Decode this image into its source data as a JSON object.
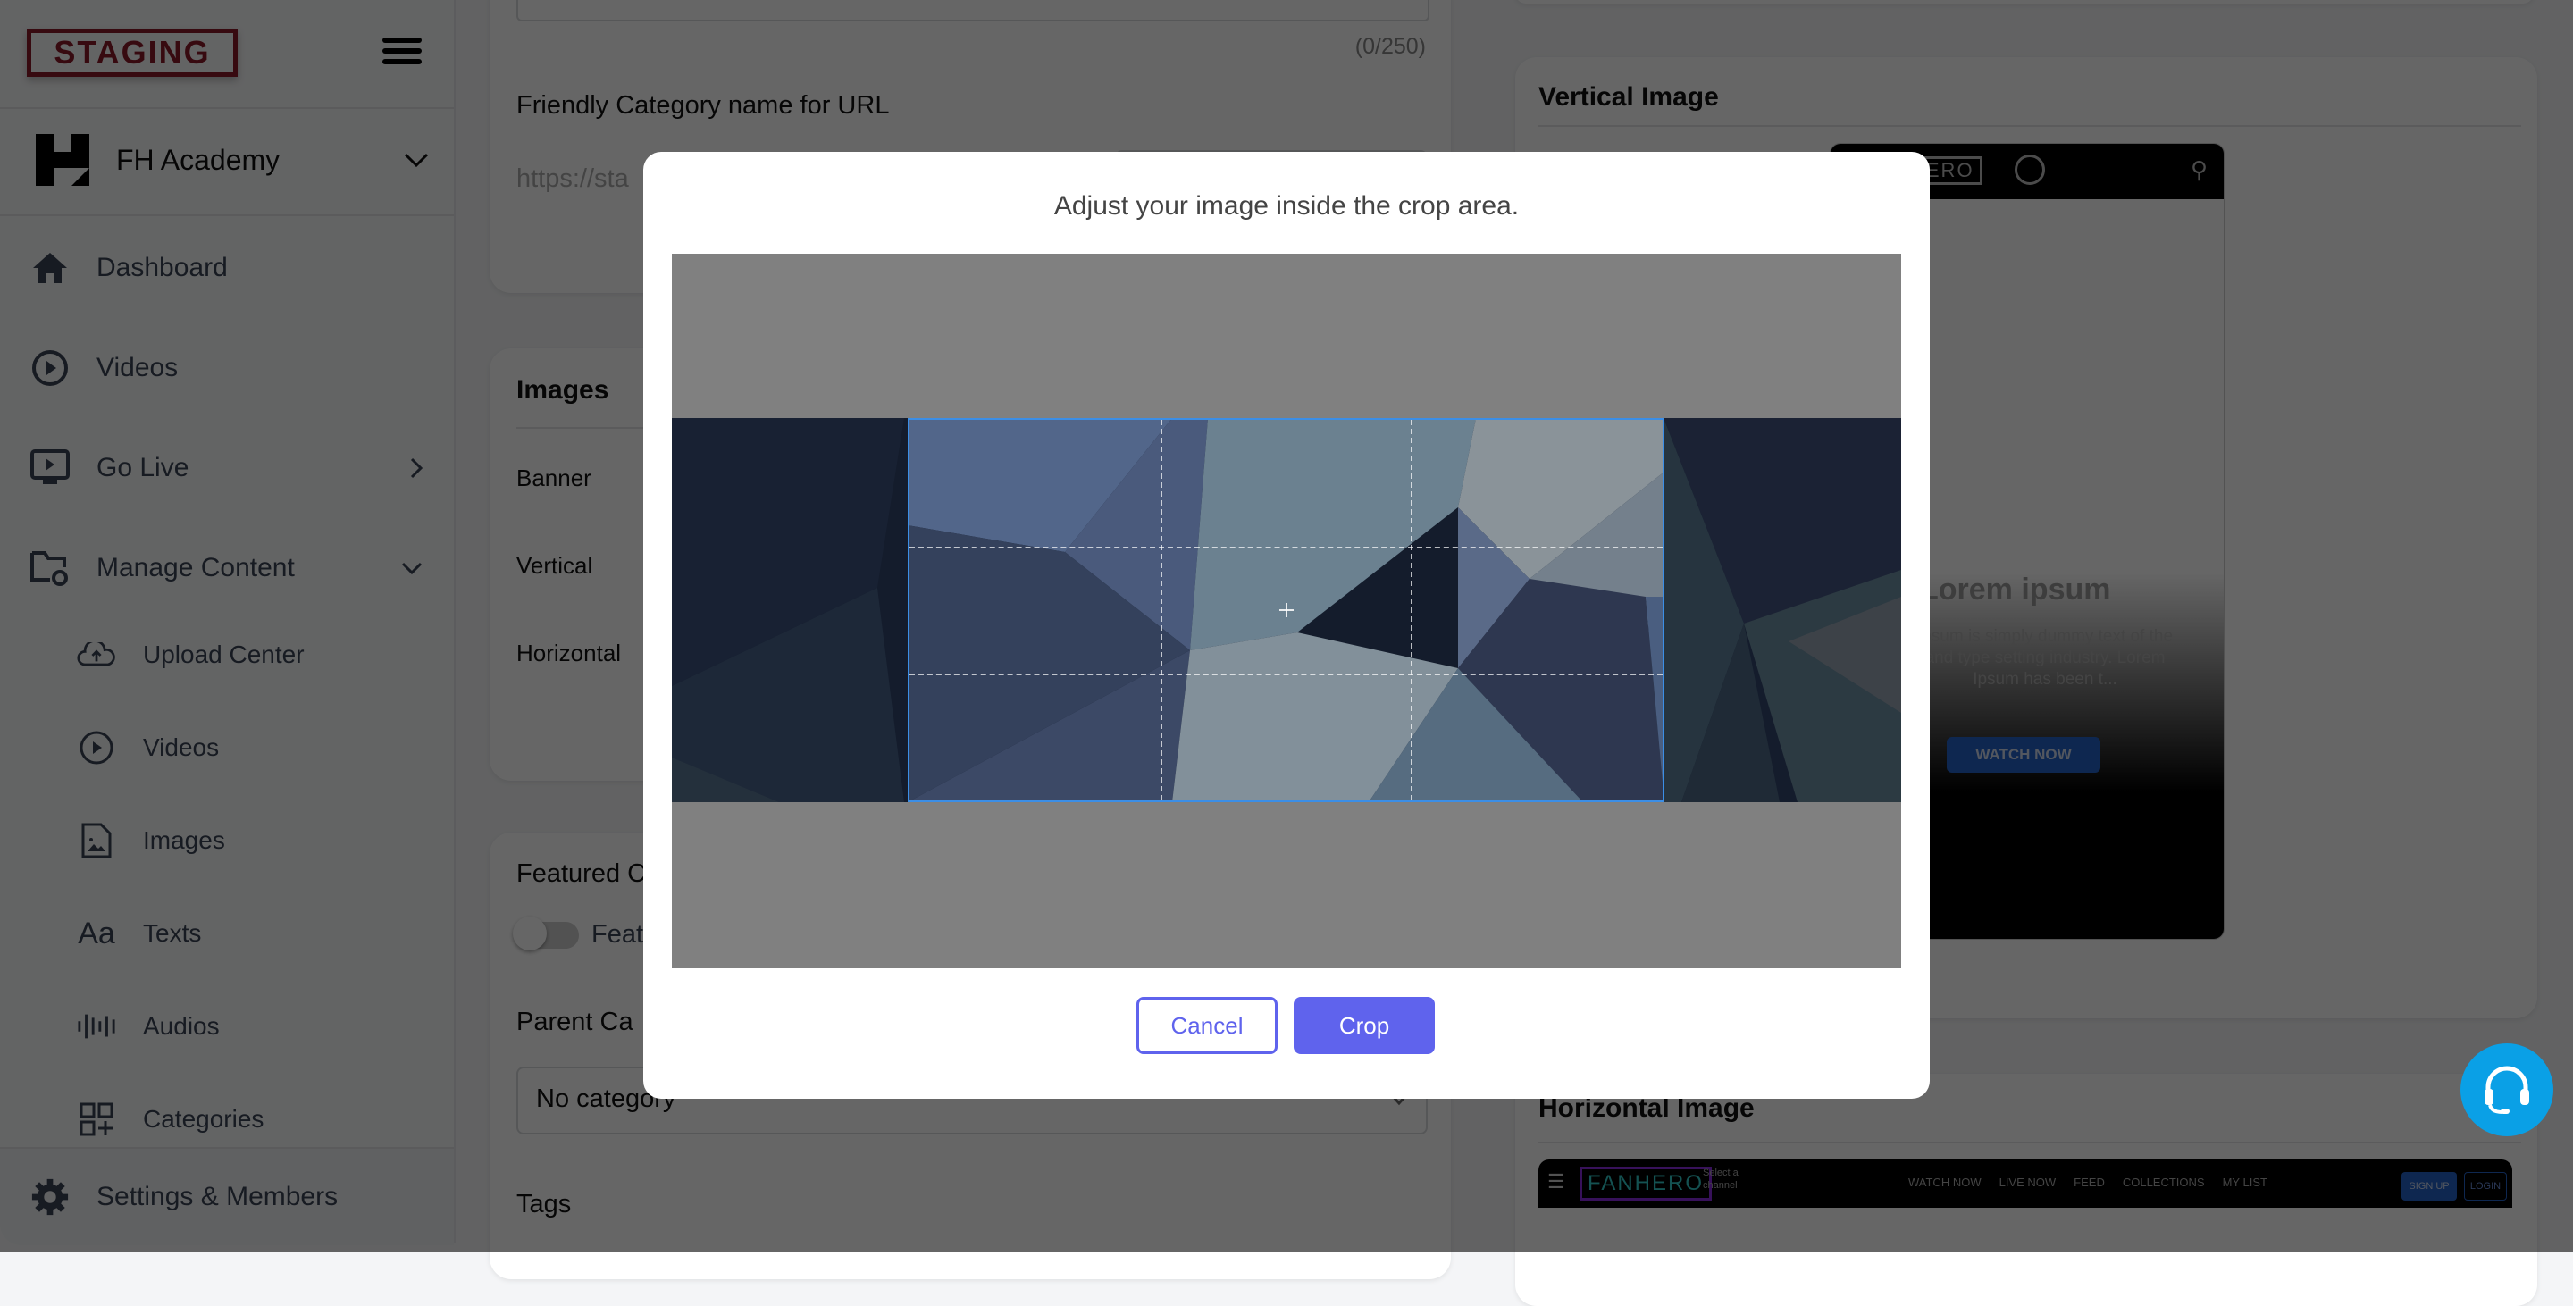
{
  "sidebar": {
    "logo": "STAGING",
    "org_name": "FH Academy",
    "items": [
      {
        "label": "Dashboard",
        "icon": "home-icon"
      },
      {
        "label": "Videos",
        "icon": "play-circle-icon"
      },
      {
        "label": "Go Live",
        "icon": "live-screen-icon"
      },
      {
        "label": "Manage Content",
        "icon": "folder-gear-icon"
      }
    ],
    "sub_items": [
      {
        "label": "Upload Center",
        "icon": "cloud-upload-icon"
      },
      {
        "label": "Videos",
        "icon": "play-circle-icon"
      },
      {
        "label": "Images",
        "icon": "image-file-icon"
      },
      {
        "label": "Texts",
        "icon": "text-icon"
      },
      {
        "label": "Audios",
        "icon": "audio-wave-icon"
      },
      {
        "label": "Categories",
        "icon": "grid-plus-icon"
      }
    ],
    "footer": {
      "label": "Settings & Members",
      "icon": "gear-icon"
    }
  },
  "form": {
    "char_count": "(0/250)",
    "friendly_name_label": "Friendly Category name for URL",
    "friendly_name_prefix": "https://sta",
    "images_title": "Images",
    "image_rows": [
      "Banner",
      "Vertical",
      "Horizontal"
    ],
    "featured_title": "Featured C",
    "featured_toggle_label": "Feat",
    "parent_category_label": "Parent Ca",
    "parent_category_value": "No category",
    "tags_label": "Tags"
  },
  "previews": {
    "vertical_title": "Vertical Image",
    "vertical_brand": "HERO",
    "vertical_hero_title": "Lorem ipsum",
    "vertical_hero_text": "Ipsum is simply dummy text of the and type setting industry. Lorem Ipsum has been t...",
    "vertical_cta": "WATCH NOW",
    "horizontal_title": "Horizontal Image",
    "horizontal_brand": "FANHERO",
    "horizontal_select": "Select a channel",
    "horizontal_nav": [
      "WATCH NOW",
      "LIVE NOW",
      "FEED",
      "COLLECTIONS",
      "MY LIST"
    ],
    "horizontal_signup": "SIGN UP",
    "horizontal_login": "LOGIN"
  },
  "dialog": {
    "title": "Adjust your image inside the crop area.",
    "cancel_label": "Cancel",
    "crop_label": "Crop"
  },
  "colors": {
    "accent": "#5f63ed",
    "staging": "#8b1a2a",
    "support": "#0aa0e6",
    "crop_border": "#3b8ee6"
  }
}
